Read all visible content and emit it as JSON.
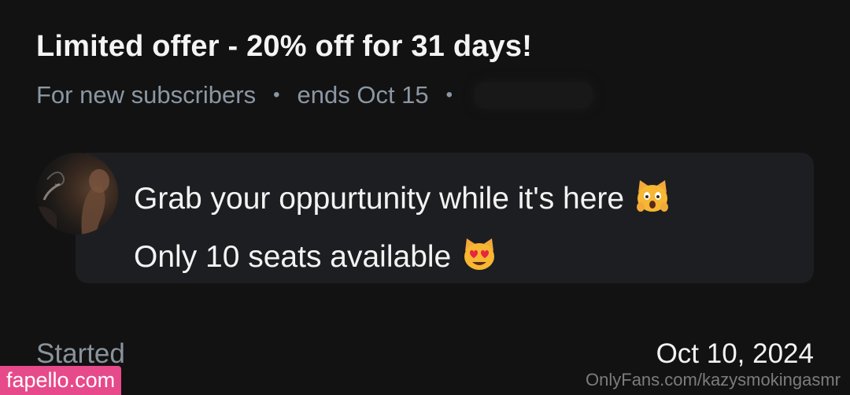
{
  "offer": {
    "title": "Limited offer - 20% off for 31 days!",
    "audience": "For new subscribers",
    "separator": "•",
    "ends": "ends Oct 15"
  },
  "message": {
    "line1": "Grab your oppurtunity while it's here",
    "line1_emoji": "weary-cat-face",
    "line2": "Only 10 seats available",
    "line2_emoji": "smiling-cat-heart-eyes"
  },
  "footer": {
    "started_label": "Started",
    "started_date": "Oct 10, 2024"
  },
  "watermarks": {
    "left": "fapello.com",
    "right": "OnlyFans.com/kazysmokingasmr"
  },
  "colors": {
    "background": "#121212",
    "bubble": "#1d1e21",
    "muted": "#8b97a3",
    "text": "#f3f3f3",
    "watermark_badge": "#e64a8a"
  }
}
